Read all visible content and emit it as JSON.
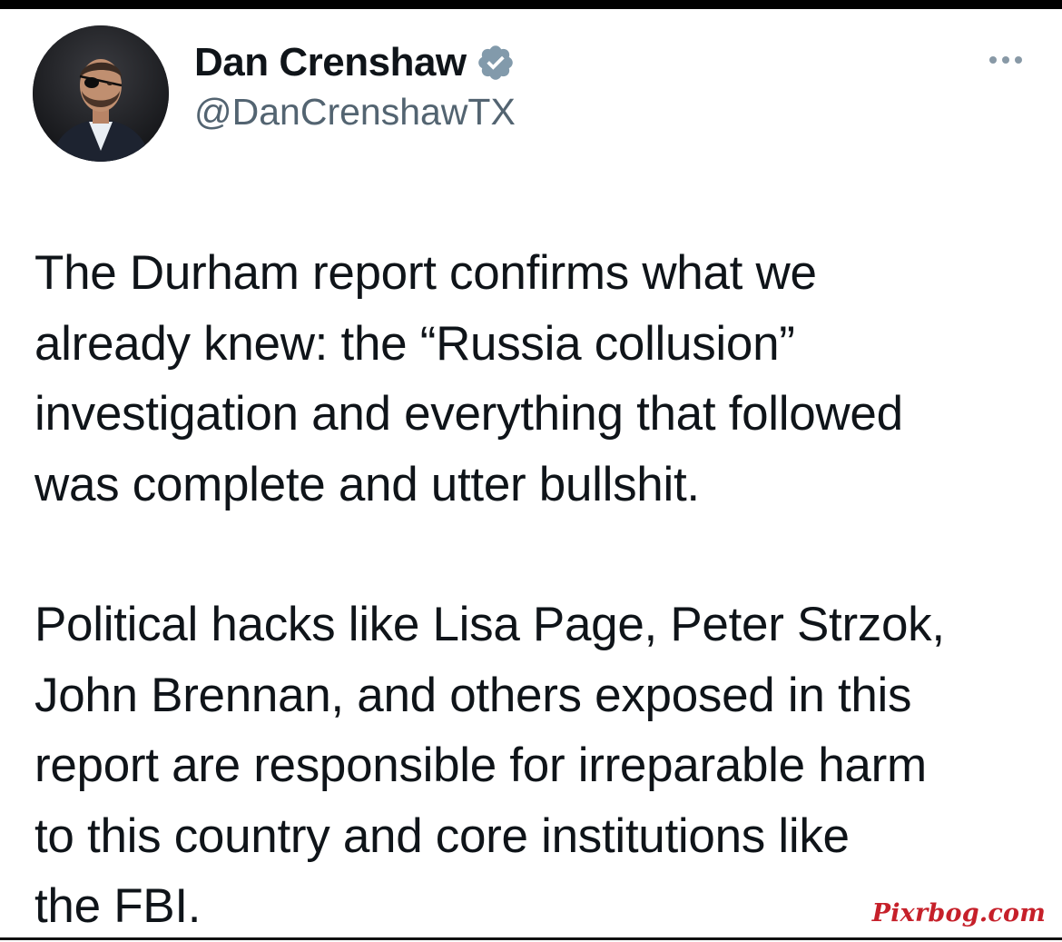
{
  "author": {
    "display_name": "Dan Crenshaw",
    "handle": "@DanCrenshawTX",
    "verified": true,
    "avatar_icon": "profile-photo",
    "verified_icon": "verified-badge-icon",
    "verified_color": "#829aab"
  },
  "menu": {
    "icon": "more-horizontal-icon"
  },
  "tweet": {
    "paragraphs": [
      "The Durham report confirms what we\nalready knew: the “Russia collusion”\ninvestigation and everything that followed\nwas complete and utter bullshit.",
      "Political hacks like Lisa Page, Peter Strzok,\nJohn Brennan, and others exposed in this\nreport are responsible for irreparable harm\nto this country and core institutions like\nthe FBI."
    ]
  },
  "watermark": {
    "text": "Pixrbog.com",
    "color": "#c6202a"
  }
}
